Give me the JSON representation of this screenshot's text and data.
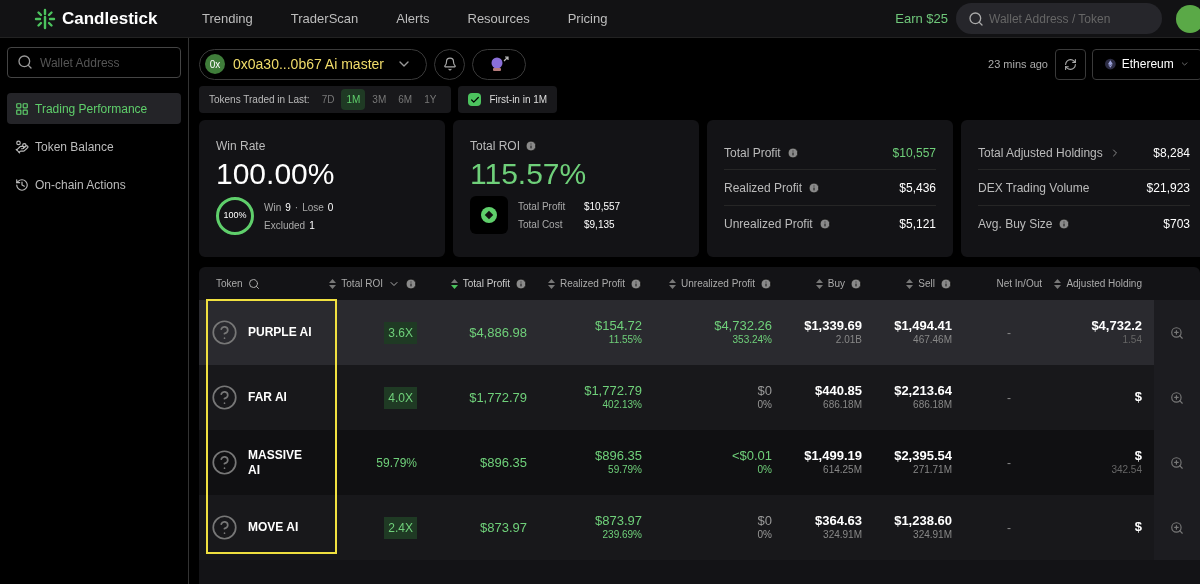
{
  "header": {
    "brand": "Candlestick",
    "nav": [
      {
        "label": "Trending"
      },
      {
        "label": "TraderScan"
      },
      {
        "label": "Alerts"
      },
      {
        "label": "Resources"
      },
      {
        "label": "Pricing"
      }
    ],
    "earn": "Earn $25",
    "search": {
      "placeholder": "Wallet Address / Token"
    }
  },
  "sidebar": {
    "search": {
      "placeholder": "Wallet Address"
    },
    "items": [
      {
        "label": "Trading Performance",
        "selected": true
      },
      {
        "label": "Token Balance",
        "selected": false
      },
      {
        "label": "On-chain Actions",
        "selected": false
      }
    ]
  },
  "wallet": {
    "badge": "0x",
    "name": "0x0a30...0b67 Ai master",
    "updated": "23 mins ago",
    "chain": "Ethereum"
  },
  "timeframe": {
    "label": "Tokens Traded in Last:",
    "options": [
      {
        "label": "7D",
        "selected": false
      },
      {
        "label": "1M",
        "selected": true
      },
      {
        "label": "3M",
        "selected": false
      },
      {
        "label": "6M",
        "selected": false
      },
      {
        "label": "1Y",
        "selected": false
      }
    ],
    "first_in": {
      "label": "First-in in 1M",
      "checked": true
    }
  },
  "win_rate": {
    "title": "Win Rate",
    "value": "100.00%",
    "ring": "100%",
    "win_label": "Win",
    "win": "9",
    "sep": "·",
    "lose_label": "Lose",
    "lose": "0",
    "excluded_label": "Excluded",
    "excluded": "1"
  },
  "roi": {
    "title": "Total ROI",
    "value": "115.57%",
    "rows": [
      {
        "label": "Total Profit",
        "value": "$10,557"
      },
      {
        "label": "Total Cost",
        "value": "$9,135"
      }
    ]
  },
  "profit_card": [
    {
      "label": "Total Profit",
      "value": "$10,557",
      "green": true
    },
    {
      "label": "Realized Profit",
      "value": "$5,436",
      "green": false
    },
    {
      "label": "Unrealized Profit",
      "value": "$5,121",
      "green": false
    }
  ],
  "holdings_card": [
    {
      "label": "Total Adjusted Holdings",
      "value": "$8,284"
    },
    {
      "label": "DEX Trading Volume",
      "value": "$21,923"
    },
    {
      "label": "Avg. Buy Size",
      "value": "$703"
    }
  ],
  "table": {
    "token_column_highlighted": true,
    "columns": [
      {
        "label": "Token",
        "selected": false
      },
      {
        "label": "Total ROI",
        "selected": false
      },
      {
        "label": "Total Profit",
        "selected": true
      },
      {
        "label": "Realized Profit",
        "selected": false
      },
      {
        "label": "Unrealized Profit",
        "selected": false
      },
      {
        "label": "Buy",
        "selected": false
      },
      {
        "label": "Sell",
        "selected": false
      },
      {
        "label": "Net In/Out",
        "selected": false
      },
      {
        "label": "Adjusted Holding",
        "selected": false
      }
    ],
    "rows": [
      {
        "selected": true,
        "token": "PURPLE AI",
        "roi": {
          "kind": "badge",
          "value": "3.6X"
        },
        "total_profit": "$4,886.98",
        "realized": {
          "value": "$154.72",
          "sub": "11.55%",
          "green": true
        },
        "unrealized": {
          "value": "$4,732.26",
          "sub": "353.24%",
          "green": true
        },
        "buy": {
          "value": "$1,339.69",
          "sub": "2.01B"
        },
        "sell": {
          "value": "$1,494.41",
          "sub": "467.46M"
        },
        "net": "-",
        "holding": {
          "value": "$4,732.2",
          "sub": "1.54"
        }
      },
      {
        "selected": false,
        "token": "FAR AI",
        "roi": {
          "kind": "badge",
          "value": "4.0X"
        },
        "total_profit": "$1,772.79",
        "realized": {
          "value": "$1,772.79",
          "sub": "402.13%",
          "green": true
        },
        "unrealized": {
          "value": "$0",
          "sub": "0%",
          "green": false
        },
        "buy": {
          "value": "$440.85",
          "sub": "686.18M"
        },
        "sell": {
          "value": "$2,213.64",
          "sub": "686.18M"
        },
        "net": "-",
        "holding": {
          "value": "$"
        }
      },
      {
        "selected": false,
        "token": "MASSIVE AI",
        "roi": {
          "kind": "text",
          "value": "59.79%"
        },
        "total_profit": "$896.35",
        "realized": {
          "value": "$896.35",
          "sub": "59.79%",
          "green": true
        },
        "unrealized": {
          "value": "<$0.01",
          "sub": "0%",
          "green": true
        },
        "buy": {
          "value": "$1,499.19",
          "sub": "614.25M"
        },
        "sell": {
          "value": "$2,395.54",
          "sub": "271.71M"
        },
        "net": "-",
        "holding": {
          "value": "$",
          "sub": "342.54"
        }
      },
      {
        "selected": false,
        "token": "MOVE AI",
        "roi": {
          "kind": "badge",
          "value": "2.4X"
        },
        "total_profit": "$873.97",
        "realized": {
          "value": "$873.97",
          "sub": "239.69%",
          "green": true
        },
        "unrealized": {
          "value": "$0",
          "sub": "0%",
          "green": false
        },
        "buy": {
          "value": "$364.63",
          "sub": "324.91M"
        },
        "sell": {
          "value": "$1,238.60",
          "sub": "324.91M"
        },
        "net": "-",
        "holding": {
          "value": "$"
        }
      }
    ]
  }
}
